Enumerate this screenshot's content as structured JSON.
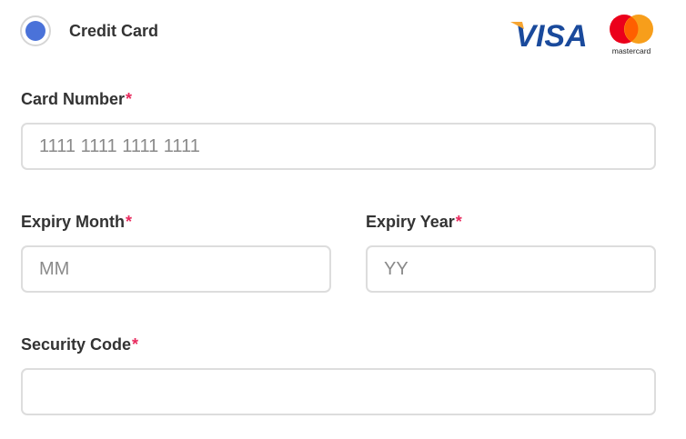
{
  "payment_method": {
    "label": "Credit Card",
    "selected": true,
    "radio_color": "#4a72d9",
    "logos": {
      "visa": {
        "text": "VISA",
        "color": "#1a4a9c",
        "accent": "#f7a531"
      },
      "mastercard": {
        "text": "mastercard",
        "colors": [
          "#eb001b",
          "#f79e1b",
          "#ff5f00"
        ]
      }
    }
  },
  "required_marker": "*",
  "required_color": "#e8295d",
  "fields": {
    "card_number": {
      "label": "Card Number",
      "placeholder": "1111 1111 1111 1111",
      "value": ""
    },
    "expiry_month": {
      "label": "Expiry Month",
      "placeholder": "MM",
      "value": ""
    },
    "expiry_year": {
      "label": "Expiry Year",
      "placeholder": "YY",
      "value": ""
    },
    "security_code": {
      "label": "Security Code",
      "placeholder": "",
      "value": ""
    }
  }
}
